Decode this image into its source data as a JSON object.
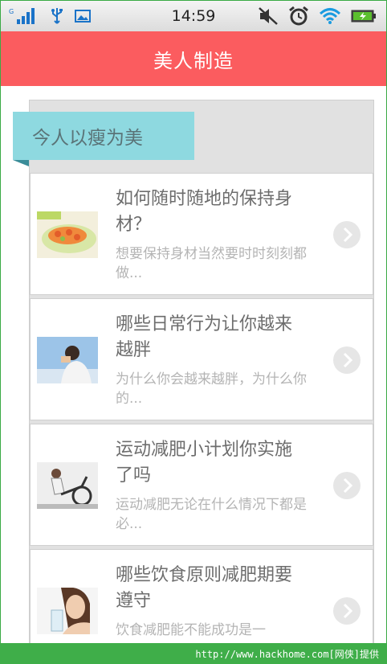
{
  "status_bar": {
    "time": "14:59",
    "network_label": "G",
    "icons_left": [
      "signal-icon",
      "usb-icon",
      "image-icon"
    ],
    "icons_right": [
      "mute-icon",
      "alarm-icon",
      "wifi-icon",
      "battery-icon"
    ]
  },
  "app_bar": {
    "title": "美人制造"
  },
  "section": {
    "ribbon_label": "今人以瘦为美"
  },
  "articles": [
    {
      "title": "如何随时随地的保持身材？",
      "summary": "想要保持身材当然要时时刻刻都做...",
      "thumb": "salad"
    },
    {
      "title": "哪些日常行为让你越来越胖",
      "summary": "为什么你会越来越胖，为什么你的...",
      "thumb": "person-eating"
    },
    {
      "title": "运动减肥小计划你实施了吗",
      "summary": "运动减肥无论在什么情况下都是必...",
      "thumb": "exercise-bike"
    },
    {
      "title": "哪些饮食原则减肥期要遵守",
      "summary": "饮食减肥能不能成功是一",
      "thumb": "woman-drinking"
    }
  ],
  "watermark": {
    "text": "http://www.hackhome.com[网侠]提供"
  },
  "colors": {
    "app_bar": "#fb5c5f",
    "ribbon": "#8ed9e0",
    "watermark": "#3fae49"
  }
}
